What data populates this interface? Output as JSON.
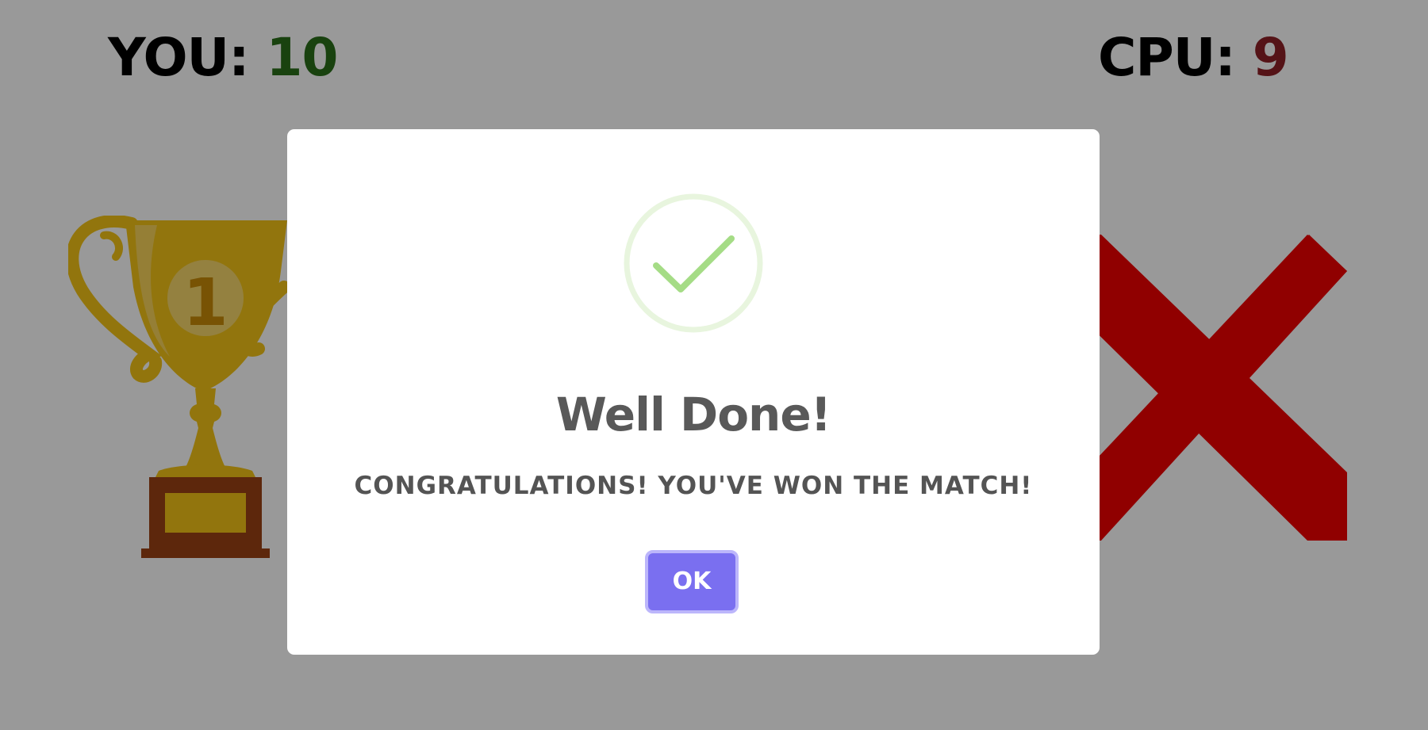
{
  "scoreboard": {
    "you_label": "YOU: ",
    "you_score": "10",
    "cpu_label": "CPU: ",
    "cpu_score": "9"
  },
  "board": {
    "left_icon": "trophy-icon",
    "trophy_rank": "1",
    "right_icon": "red-cross-icon"
  },
  "modal": {
    "icon": "checkmark-circle-icon",
    "title": "Well Done!",
    "message": "CONGRATULATIONS! YOU'VE WON THE MATCH!",
    "confirm_label": "OK"
  },
  "colors": {
    "you_score": "#2a6e1a",
    "cpu_score": "#8e2127",
    "button_bg": "#7a6ff0",
    "button_border": "#bcb6fb",
    "success_green": "#a5dc86"
  }
}
